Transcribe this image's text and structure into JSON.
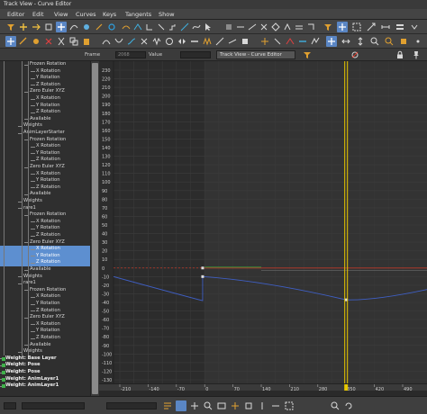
{
  "window": {
    "title": "Track View - Curve Editor"
  },
  "menu": [
    "Editor",
    "Edit",
    "View",
    "Curves",
    "Keys",
    "Tangents",
    "Show"
  ],
  "framebar": {
    "frame_label": "Frame",
    "frame_value": "2068",
    "value_label": "Value",
    "name_field": "Track View - Curve Editor"
  },
  "tree": [
    {
      "label": "Frozen Rotation",
      "indent": 2,
      "style": "normal"
    },
    {
      "label": "X Rotation",
      "indent": 3,
      "style": "normal"
    },
    {
      "label": "Y Rotation",
      "indent": 3,
      "style": "normal"
    },
    {
      "label": "Z Rotation",
      "indent": 3,
      "style": "normal"
    },
    {
      "label": "Zero Euler XYZ",
      "indent": 2,
      "style": "normal"
    },
    {
      "label": "X Rotation",
      "indent": 3,
      "style": "normal"
    },
    {
      "label": "Y Rotation",
      "indent": 3,
      "style": "normal"
    },
    {
      "label": "Z Rotation",
      "indent": 3,
      "style": "normal"
    },
    {
      "label": "Available",
      "indent": 2,
      "style": "normal"
    },
    {
      "label": "Weights",
      "indent": 1,
      "style": "normal"
    },
    {
      "label": "AnimLayerStarter",
      "indent": 1,
      "style": "normal"
    },
    {
      "label": "Frozen Rotation",
      "indent": 2,
      "style": "normal"
    },
    {
      "label": "X Rotation",
      "indent": 3,
      "style": "normal"
    },
    {
      "label": "Y Rotation",
      "indent": 3,
      "style": "normal"
    },
    {
      "label": "Z Rotation",
      "indent": 3,
      "style": "normal"
    },
    {
      "label": "Zero Euler XYZ",
      "indent": 2,
      "style": "normal"
    },
    {
      "label": "X Rotation",
      "indent": 3,
      "style": "normal"
    },
    {
      "label": "Y Rotation",
      "indent": 3,
      "style": "normal"
    },
    {
      "label": "Z Rotation",
      "indent": 3,
      "style": "normal"
    },
    {
      "label": "Available",
      "indent": 2,
      "style": "normal"
    },
    {
      "label": "Weights",
      "indent": 1,
      "style": "normal"
    },
    {
      "label": "rare1",
      "indent": 1,
      "style": "normal"
    },
    {
      "label": "Frozen Rotation",
      "indent": 2,
      "style": "normal"
    },
    {
      "label": "X Rotation",
      "indent": 3,
      "style": "normal"
    },
    {
      "label": "Y Rotation",
      "indent": 3,
      "style": "normal"
    },
    {
      "label": "Z Rotation",
      "indent": 3,
      "style": "normal"
    },
    {
      "label": "Zero Euler XYZ",
      "indent": 2,
      "style": "normal"
    },
    {
      "label": "X Rotation",
      "indent": 3,
      "style": "selected"
    },
    {
      "label": "Y Rotation",
      "indent": 3,
      "style": "selected"
    },
    {
      "label": "Z Rotation",
      "indent": 3,
      "style": "selected"
    },
    {
      "label": "Available",
      "indent": 2,
      "style": "normal"
    },
    {
      "label": "Weights",
      "indent": 1,
      "style": "normal"
    },
    {
      "label": "rare1",
      "indent": 1,
      "style": "normal"
    },
    {
      "label": "Frozen Rotation",
      "indent": 2,
      "style": "normal"
    },
    {
      "label": "X Rotation",
      "indent": 3,
      "style": "normal"
    },
    {
      "label": "Y Rotation",
      "indent": 3,
      "style": "normal"
    },
    {
      "label": "Z Rotation",
      "indent": 3,
      "style": "normal"
    },
    {
      "label": "Zero Euler XYZ",
      "indent": 2,
      "style": "normal"
    },
    {
      "label": "X Rotation",
      "indent": 3,
      "style": "normal"
    },
    {
      "label": "Y Rotation",
      "indent": 3,
      "style": "normal"
    },
    {
      "label": "Z Rotation",
      "indent": 3,
      "style": "normal"
    },
    {
      "label": "Available",
      "indent": 2,
      "style": "normal"
    },
    {
      "label": "Weights",
      "indent": 1,
      "style": "normal"
    },
    {
      "label": "Weight: Base Layer",
      "indent": 0,
      "style": "bold"
    },
    {
      "label": "Weight: Pose",
      "indent": 0,
      "style": "bold"
    },
    {
      "label": "Weight: Pose",
      "indent": 0,
      "style": "bold"
    },
    {
      "label": "Weight: AnimLayer1",
      "indent": 0,
      "style": "bold"
    },
    {
      "label": "Weight: AnimLayer1",
      "indent": 0,
      "style": "bold"
    }
  ],
  "y_ticks": [
    "230",
    "220",
    "210",
    "200",
    "190",
    "180",
    "170",
    "160",
    "150",
    "140",
    "130",
    "120",
    "110",
    "100",
    "90",
    "80",
    "70",
    "60",
    "50",
    "40",
    "30",
    "20",
    "10",
    "0",
    "-10",
    "-20",
    "-30",
    "-40",
    "-50",
    "-60",
    "-70",
    "-80",
    "-90",
    "-100",
    "-110",
    "-120",
    "-130"
  ],
  "x_ticks": [
    "-210",
    "-140",
    "-70",
    "0",
    "70",
    "140",
    "210",
    "280",
    "350",
    "420",
    "490"
  ],
  "x_current": 350,
  "colors": {
    "accent": "#5a86c4",
    "time_slider": "#e8c800",
    "curve_blue": "#3f5fc4",
    "curve_red": "#c03a2a",
    "curve_green": "#3a9c3a"
  },
  "icons": [
    "filter-icon",
    "move-keys-icon",
    "slide-keys-icon",
    "scale-keys-icon",
    "scale-values-icon",
    "add-keys-icon",
    "draw-curves-icon",
    "reduce-keys-icon",
    "lock-icon",
    "snap-icon"
  ]
}
